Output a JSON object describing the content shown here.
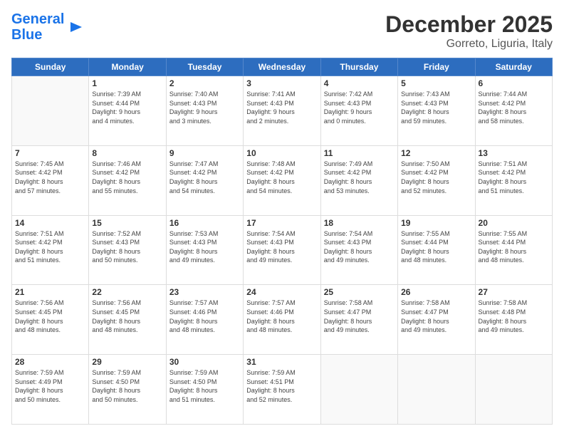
{
  "header": {
    "logo_line1": "General",
    "logo_line2": "Blue",
    "title": "December 2025",
    "subtitle": "Gorreto, Liguria, Italy"
  },
  "weekdays": [
    "Sunday",
    "Monday",
    "Tuesday",
    "Wednesday",
    "Thursday",
    "Friday",
    "Saturday"
  ],
  "weeks": [
    [
      {
        "day": "",
        "sunrise": "",
        "sunset": "",
        "daylight": ""
      },
      {
        "day": "1",
        "sunrise": "7:39 AM",
        "sunset": "4:44 PM",
        "daylight": "9 hours and 4 minutes."
      },
      {
        "day": "2",
        "sunrise": "7:40 AM",
        "sunset": "4:43 PM",
        "daylight": "9 hours and 3 minutes."
      },
      {
        "day": "3",
        "sunrise": "7:41 AM",
        "sunset": "4:43 PM",
        "daylight": "9 hours and 2 minutes."
      },
      {
        "day": "4",
        "sunrise": "7:42 AM",
        "sunset": "4:43 PM",
        "daylight": "9 hours and 0 minutes."
      },
      {
        "day": "5",
        "sunrise": "7:43 AM",
        "sunset": "4:43 PM",
        "daylight": "8 hours and 59 minutes."
      },
      {
        "day": "6",
        "sunrise": "7:44 AM",
        "sunset": "4:42 PM",
        "daylight": "8 hours and 58 minutes."
      }
    ],
    [
      {
        "day": "7",
        "sunrise": "7:45 AM",
        "sunset": "4:42 PM",
        "daylight": "8 hours and 57 minutes."
      },
      {
        "day": "8",
        "sunrise": "7:46 AM",
        "sunset": "4:42 PM",
        "daylight": "8 hours and 55 minutes."
      },
      {
        "day": "9",
        "sunrise": "7:47 AM",
        "sunset": "4:42 PM",
        "daylight": "8 hours and 54 minutes."
      },
      {
        "day": "10",
        "sunrise": "7:48 AM",
        "sunset": "4:42 PM",
        "daylight": "8 hours and 54 minutes."
      },
      {
        "day": "11",
        "sunrise": "7:49 AM",
        "sunset": "4:42 PM",
        "daylight": "8 hours and 53 minutes."
      },
      {
        "day": "12",
        "sunrise": "7:50 AM",
        "sunset": "4:42 PM",
        "daylight": "8 hours and 52 minutes."
      },
      {
        "day": "13",
        "sunrise": "7:51 AM",
        "sunset": "4:42 PM",
        "daylight": "8 hours and 51 minutes."
      }
    ],
    [
      {
        "day": "14",
        "sunrise": "7:51 AM",
        "sunset": "4:42 PM",
        "daylight": "8 hours and 51 minutes."
      },
      {
        "day": "15",
        "sunrise": "7:52 AM",
        "sunset": "4:43 PM",
        "daylight": "8 hours and 50 minutes."
      },
      {
        "day": "16",
        "sunrise": "7:53 AM",
        "sunset": "4:43 PM",
        "daylight": "8 hours and 49 minutes."
      },
      {
        "day": "17",
        "sunrise": "7:54 AM",
        "sunset": "4:43 PM",
        "daylight": "8 hours and 49 minutes."
      },
      {
        "day": "18",
        "sunrise": "7:54 AM",
        "sunset": "4:43 PM",
        "daylight": "8 hours and 49 minutes."
      },
      {
        "day": "19",
        "sunrise": "7:55 AM",
        "sunset": "4:44 PM",
        "daylight": "8 hours and 48 minutes."
      },
      {
        "day": "20",
        "sunrise": "7:55 AM",
        "sunset": "4:44 PM",
        "daylight": "8 hours and 48 minutes."
      }
    ],
    [
      {
        "day": "21",
        "sunrise": "7:56 AM",
        "sunset": "4:45 PM",
        "daylight": "8 hours and 48 minutes."
      },
      {
        "day": "22",
        "sunrise": "7:56 AM",
        "sunset": "4:45 PM",
        "daylight": "8 hours and 48 minutes."
      },
      {
        "day": "23",
        "sunrise": "7:57 AM",
        "sunset": "4:46 PM",
        "daylight": "8 hours and 48 minutes."
      },
      {
        "day": "24",
        "sunrise": "7:57 AM",
        "sunset": "4:46 PM",
        "daylight": "8 hours and 48 minutes."
      },
      {
        "day": "25",
        "sunrise": "7:58 AM",
        "sunset": "4:47 PM",
        "daylight": "8 hours and 49 minutes."
      },
      {
        "day": "26",
        "sunrise": "7:58 AM",
        "sunset": "4:47 PM",
        "daylight": "8 hours and 49 minutes."
      },
      {
        "day": "27",
        "sunrise": "7:58 AM",
        "sunset": "4:48 PM",
        "daylight": "8 hours and 49 minutes."
      }
    ],
    [
      {
        "day": "28",
        "sunrise": "7:59 AM",
        "sunset": "4:49 PM",
        "daylight": "8 hours and 50 minutes."
      },
      {
        "day": "29",
        "sunrise": "7:59 AM",
        "sunset": "4:50 PM",
        "daylight": "8 hours and 50 minutes."
      },
      {
        "day": "30",
        "sunrise": "7:59 AM",
        "sunset": "4:50 PM",
        "daylight": "8 hours and 51 minutes."
      },
      {
        "day": "31",
        "sunrise": "7:59 AM",
        "sunset": "4:51 PM",
        "daylight": "8 hours and 52 minutes."
      },
      {
        "day": "",
        "sunrise": "",
        "sunset": "",
        "daylight": ""
      },
      {
        "day": "",
        "sunrise": "",
        "sunset": "",
        "daylight": ""
      },
      {
        "day": "",
        "sunrise": "",
        "sunset": "",
        "daylight": ""
      }
    ]
  ]
}
